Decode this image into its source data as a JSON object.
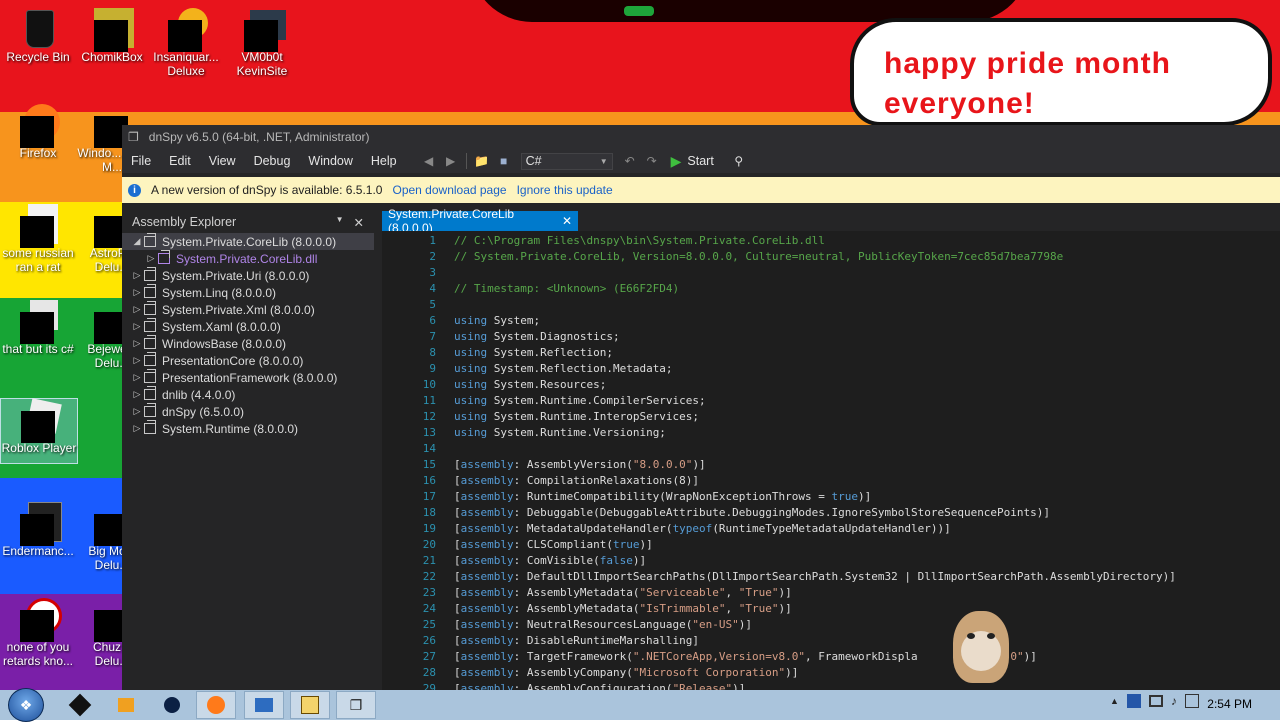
{
  "desktop": {
    "icons": [
      {
        "label": "Recycle Bin"
      },
      {
        "label": "ChomikBox"
      },
      {
        "label": "Insaniquar... Deluxe"
      },
      {
        "label": "VM0b0t KevinSite"
      },
      {
        "label": "Firefox"
      },
      {
        "label": "Windo... Live M..."
      },
      {
        "label": "some russian ran a rat"
      },
      {
        "label": "AstroP... Delu..."
      },
      {
        "label": "that but its c#"
      },
      {
        "label": "Bejewe... Delu..."
      },
      {
        "label": "Roblox Player"
      },
      {
        "label": "Endermanc..."
      },
      {
        "label": "Big Mo... Delu..."
      },
      {
        "label": "none of you retards kno..."
      },
      {
        "label": "Chuz... Delu..."
      }
    ],
    "bubble_text": "happy pride month everyone!",
    "stripe_colors": [
      "#e8141c",
      "#f7941d",
      "#ffe600",
      "#17a535",
      "#1a5bff",
      "#7a1fa8"
    ]
  },
  "window": {
    "title": "dnSpy v6.5.0 (64-bit, .NET, Administrator)",
    "menu": [
      "File",
      "Edit",
      "View",
      "Debug",
      "Window",
      "Help"
    ],
    "language": "C#",
    "start_label": "Start",
    "notice": {
      "text": "A new version of dnSpy is available: 6.5.1.0",
      "open_link": "Open download page",
      "ignore_link": "Ignore this update"
    },
    "assembly_explorer": {
      "title": "Assembly Explorer",
      "items": [
        {
          "label": "System.Private.CoreLib (8.0.0.0)",
          "expanded": true,
          "selected": true
        },
        {
          "label": "System.Private.CoreLib.dll",
          "child": true
        },
        {
          "label": "System.Private.Uri (8.0.0.0)"
        },
        {
          "label": "System.Linq (8.0.0.0)"
        },
        {
          "label": "System.Private.Xml (8.0.0.0)"
        },
        {
          "label": "System.Xaml (8.0.0.0)"
        },
        {
          "label": "WindowsBase (8.0.0.0)"
        },
        {
          "label": "PresentationCore (8.0.0.0)"
        },
        {
          "label": "PresentationFramework (8.0.0.0)"
        },
        {
          "label": "dnlib (4.4.0.0)"
        },
        {
          "label": "dnSpy (6.5.0.0)"
        },
        {
          "label": "System.Runtime (8.0.0.0)"
        }
      ]
    },
    "tab": {
      "label": "System.Private.CoreLib (8.0.0.0)"
    },
    "code_lines": [
      {
        "n": "1",
        "text": "// C:\\Program Files\\dnspy\\bin\\System.Private.CoreLib.dll"
      },
      {
        "n": "2",
        "text": "// System.Private.CoreLib, Version=8.0.0.0, Culture=neutral, PublicKeyToken=7cec85d7bea7798e"
      },
      {
        "n": "3",
        "text": ""
      },
      {
        "n": "4",
        "text": "// Timestamp: <Unknown> (E66F2FD4)"
      },
      {
        "n": "5",
        "text": ""
      },
      {
        "n": "6",
        "text": "using System;"
      },
      {
        "n": "7",
        "text": "using System.Diagnostics;"
      },
      {
        "n": "8",
        "text": "using System.Reflection;"
      },
      {
        "n": "9",
        "text": "using System.Reflection.Metadata;"
      },
      {
        "n": "10",
        "text": "using System.Resources;"
      },
      {
        "n": "11",
        "text": "using System.Runtime.CompilerServices;"
      },
      {
        "n": "12",
        "text": "using System.Runtime.InteropServices;"
      },
      {
        "n": "13",
        "text": "using System.Runtime.Versioning;"
      },
      {
        "n": "14",
        "text": ""
      },
      {
        "n": "15",
        "text": "[assembly: AssemblyVersion(\"8.0.0.0\")]"
      },
      {
        "n": "16",
        "text": "[assembly: CompilationRelaxations(8)]"
      },
      {
        "n": "17",
        "text": "[assembly: RuntimeCompatibility(WrapNonExceptionThrows = true)]"
      },
      {
        "n": "18",
        "text": "[assembly: Debuggable(DebuggableAttribute.DebuggingModes.IgnoreSymbolStoreSequencePoints)]"
      },
      {
        "n": "19",
        "text": "[assembly: MetadataUpdateHandler(typeof(RuntimeTypeMetadataUpdateHandler))]"
      },
      {
        "n": "20",
        "text": "[assembly: CLSCompliant(true)]"
      },
      {
        "n": "21",
        "text": "[assembly: ComVisible(false)]"
      },
      {
        "n": "22",
        "text": "[assembly: DefaultDllImportSearchPaths(DllImportSearchPath.System32 | DllImportSearchPath.AssemblyDirectory)]"
      },
      {
        "n": "23",
        "text": "[assembly: AssemblyMetadata(\"Serviceable\", \"True\")]"
      },
      {
        "n": "24",
        "text": "[assembly: AssemblyMetadata(\"IsTrimmable\", \"True\")]"
      },
      {
        "n": "25",
        "text": "[assembly: NeutralResourcesLanguage(\"en-US\")]"
      },
      {
        "n": "26",
        "text": "[assembly: DisableRuntimeMarshalling]"
      },
      {
        "n": "27",
        "text": "[assembly: TargetFramework(\".NETCoreApp,Version=v8.0\", FrameworkDispla      \".NET 8.0\")]"
      },
      {
        "n": "28",
        "text": "[assembly: AssemblyCompany(\"Microsoft Corporation\")]"
      },
      {
        "n": "29",
        "text": "[assembly: AssemblyConfiguration(\"Release\")]"
      }
    ]
  },
  "taskbar": {
    "clock": "2:54 PM"
  }
}
